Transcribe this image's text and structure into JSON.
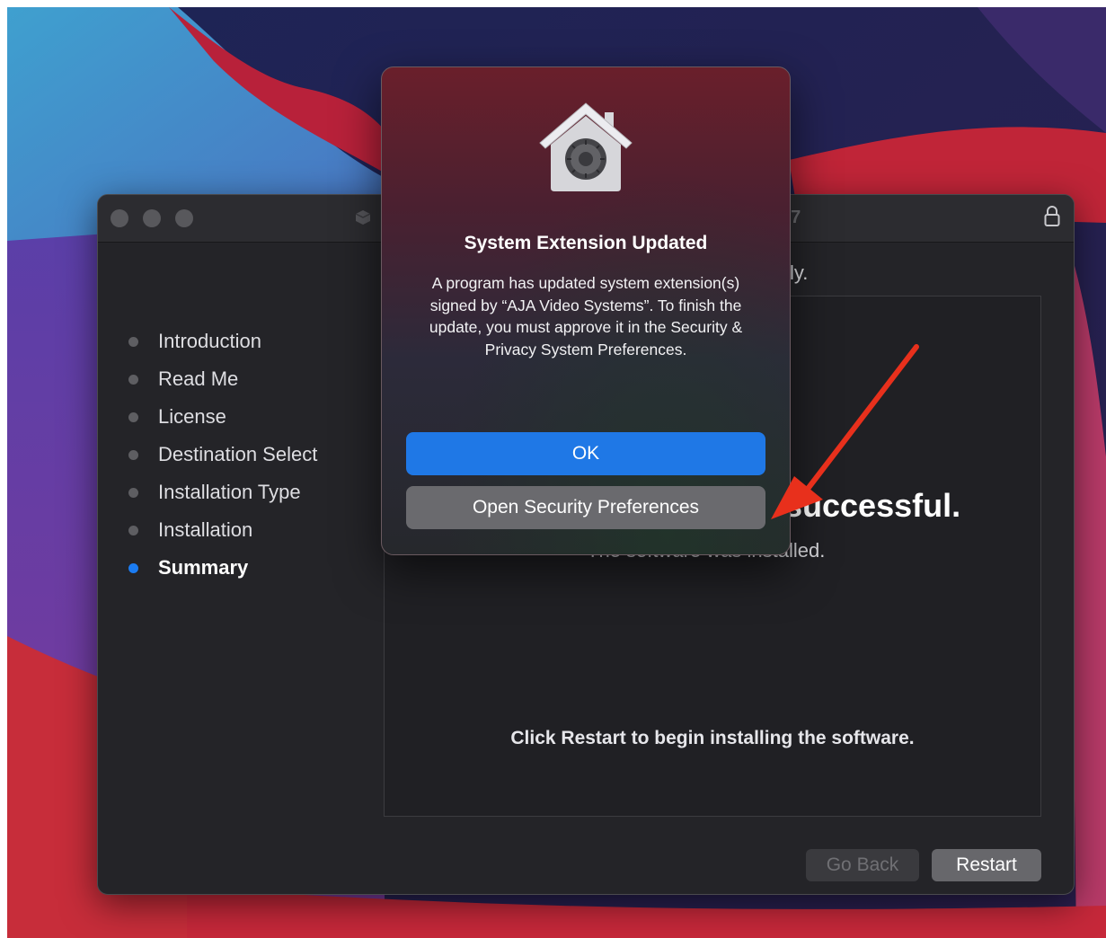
{
  "colors": {
    "accent_blue": "#1f78e6",
    "annotation_arrow": "#e8301c",
    "window_bg": "#242428"
  },
  "installer": {
    "title_fragment": "57",
    "top_text_fragment": "ly.",
    "sidebar": {
      "items": [
        {
          "label": "Introduction",
          "active": false
        },
        {
          "label": "Read Me",
          "active": false
        },
        {
          "label": "License",
          "active": false
        },
        {
          "label": "Destination Select",
          "active": false
        },
        {
          "label": "Installation Type",
          "active": false
        },
        {
          "label": "Installation",
          "active": false
        },
        {
          "label": "Summary",
          "active": true
        }
      ]
    },
    "content": {
      "success_fragment": "successful.",
      "subtitle_fragment": "The software was installed.",
      "restart_note": "Click Restart to begin installing the software."
    },
    "buttons": {
      "go_back": "Go Back",
      "restart": "Restart"
    }
  },
  "alert": {
    "icon": "security-house-vault-icon",
    "title": "System Extension Updated",
    "message": "A program has updated system extension(s) signed by “AJA Video Systems”. To finish the update, you must approve it in the Security & Privacy System Preferences.",
    "ok_label": "OK",
    "open_label": "Open Security Preferences"
  }
}
